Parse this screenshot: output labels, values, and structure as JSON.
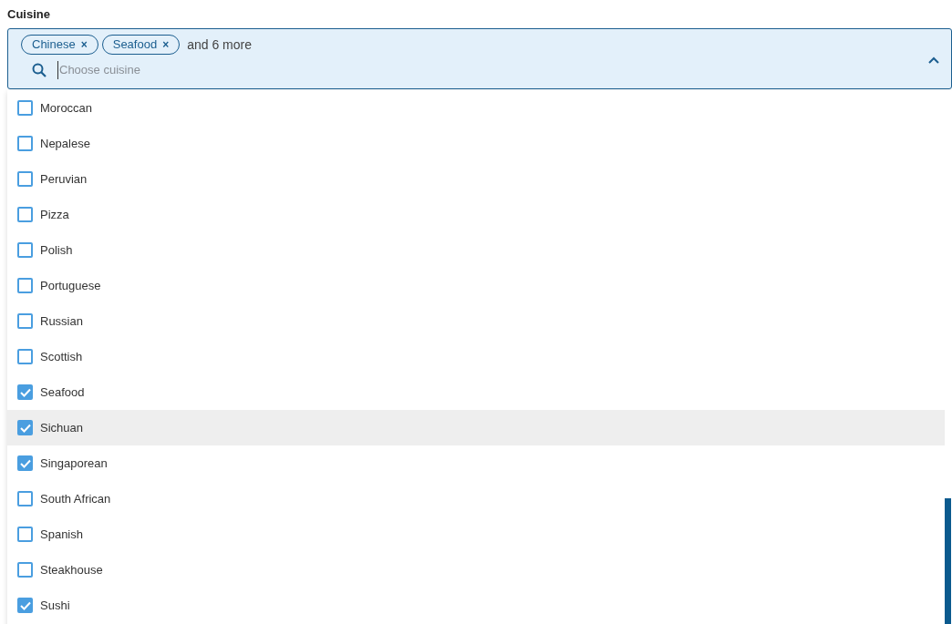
{
  "label": "Cuisine",
  "field": {
    "chips": [
      "Chinese",
      "Seafood"
    ],
    "chip_remove": "×",
    "more": "and 6 more",
    "placeholder": "Choose cuisine",
    "expanded": true
  },
  "options": [
    {
      "label": "Moroccan",
      "checked": false,
      "highlighted": false
    },
    {
      "label": "Nepalese",
      "checked": false,
      "highlighted": false
    },
    {
      "label": "Peruvian",
      "checked": false,
      "highlighted": false
    },
    {
      "label": "Pizza",
      "checked": false,
      "highlighted": false
    },
    {
      "label": "Polish",
      "checked": false,
      "highlighted": false
    },
    {
      "label": "Portuguese",
      "checked": false,
      "highlighted": false
    },
    {
      "label": "Russian",
      "checked": false,
      "highlighted": false
    },
    {
      "label": "Scottish",
      "checked": false,
      "highlighted": false
    },
    {
      "label": "Seafood",
      "checked": true,
      "highlighted": false
    },
    {
      "label": "Sichuan",
      "checked": true,
      "highlighted": true
    },
    {
      "label": "Singaporean",
      "checked": true,
      "highlighted": false
    },
    {
      "label": "South African",
      "checked": false,
      "highlighted": false
    },
    {
      "label": "Spanish",
      "checked": false,
      "highlighted": false
    },
    {
      "label": "Steakhouse",
      "checked": false,
      "highlighted": false
    },
    {
      "label": "Sushi",
      "checked": true,
      "highlighted": false
    }
  ]
}
